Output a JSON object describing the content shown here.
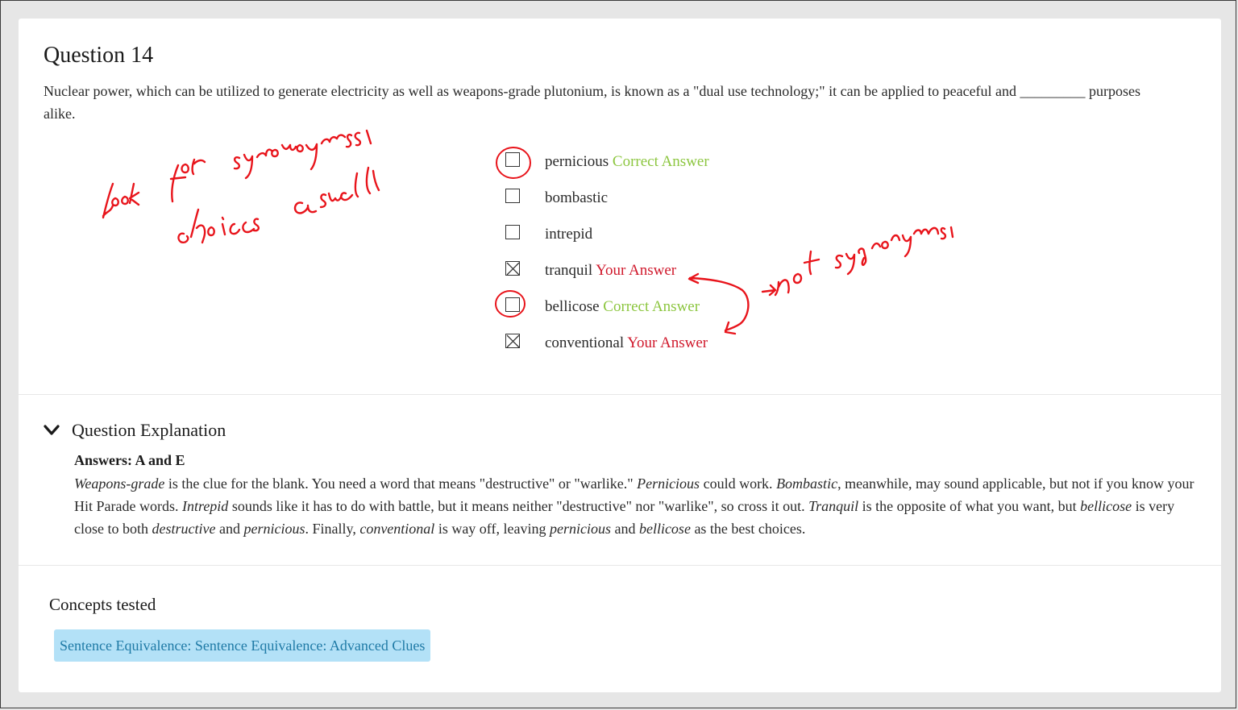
{
  "question": {
    "title": "Question 14",
    "prompt": "Nuclear power, which can be utilized to generate electricity as well as weapons-grade plutonium, is known as a \"dual use technology;\" it can be applied to peaceful and _________ purposes alike."
  },
  "choices": [
    {
      "text": "pernicious",
      "checked": false,
      "tag": "Correct Answer",
      "tag_type": "correct"
    },
    {
      "text": "bombastic",
      "checked": false,
      "tag": "",
      "tag_type": ""
    },
    {
      "text": "intrepid",
      "checked": false,
      "tag": "",
      "tag_type": ""
    },
    {
      "text": "tranquil",
      "checked": true,
      "tag": "Your Answer",
      "tag_type": "wrong"
    },
    {
      "text": "bellicose",
      "checked": false,
      "tag": "Correct Answer",
      "tag_type": "correct"
    },
    {
      "text": "conventional",
      "checked": true,
      "tag": "Your Answer",
      "tag_type": "wrong"
    }
  ],
  "explanation": {
    "toggle_label": "Question Explanation",
    "answers": "Answers: A and E",
    "body": [
      {
        "t": "Weapons-grade",
        "i": true
      },
      {
        "t": " is the clue for the blank. You need a word that means \"destructive\" or \"warlike.\" ",
        "i": false
      },
      {
        "t": "Pernicious",
        "i": true
      },
      {
        "t": " could work. ",
        "i": false
      },
      {
        "t": "Bombastic",
        "i": true
      },
      {
        "t": ", meanwhile, may sound applicable, but not if you know your Hit Parade words. ",
        "i": false
      },
      {
        "t": "Intrepid",
        "i": true
      },
      {
        "t": " sounds like it has to do with battle, but it means neither \"destructive\" nor \"warlike\", so cross it out. ",
        "i": false
      },
      {
        "t": "Tranquil",
        "i": true
      },
      {
        "t": " is the opposite of what you want, but ",
        "i": false
      },
      {
        "t": "bellicose",
        "i": true
      },
      {
        "t": " is very close to both ",
        "i": false
      },
      {
        "t": "destructive",
        "i": true
      },
      {
        "t": " and ",
        "i": false
      },
      {
        "t": "pernicious",
        "i": true
      },
      {
        "t": ". Finally, ",
        "i": false
      },
      {
        "t": "conventional",
        "i": true
      },
      {
        "t": " is way off, leaving ",
        "i": false
      },
      {
        "t": "pernicious",
        "i": true
      },
      {
        "t": " and ",
        "i": false
      },
      {
        "t": "bellicose",
        "i": true
      },
      {
        "t": " as the best choices.",
        "i": false
      }
    ]
  },
  "concepts": {
    "title": "Concepts tested",
    "items": [
      "Sentence Equivalence: Sentence Equivalence: Advanced Clues"
    ]
  },
  "annotations": {
    "ink_color": "#e8141b",
    "handwriting": [
      "look for synonyms choices as well",
      "not synonyms"
    ]
  },
  "colors": {
    "correct": "#8cc63f",
    "wrong": "#d0192c",
    "chip_bg": "#b3e1f7",
    "chip_text": "#1f7aa6"
  }
}
